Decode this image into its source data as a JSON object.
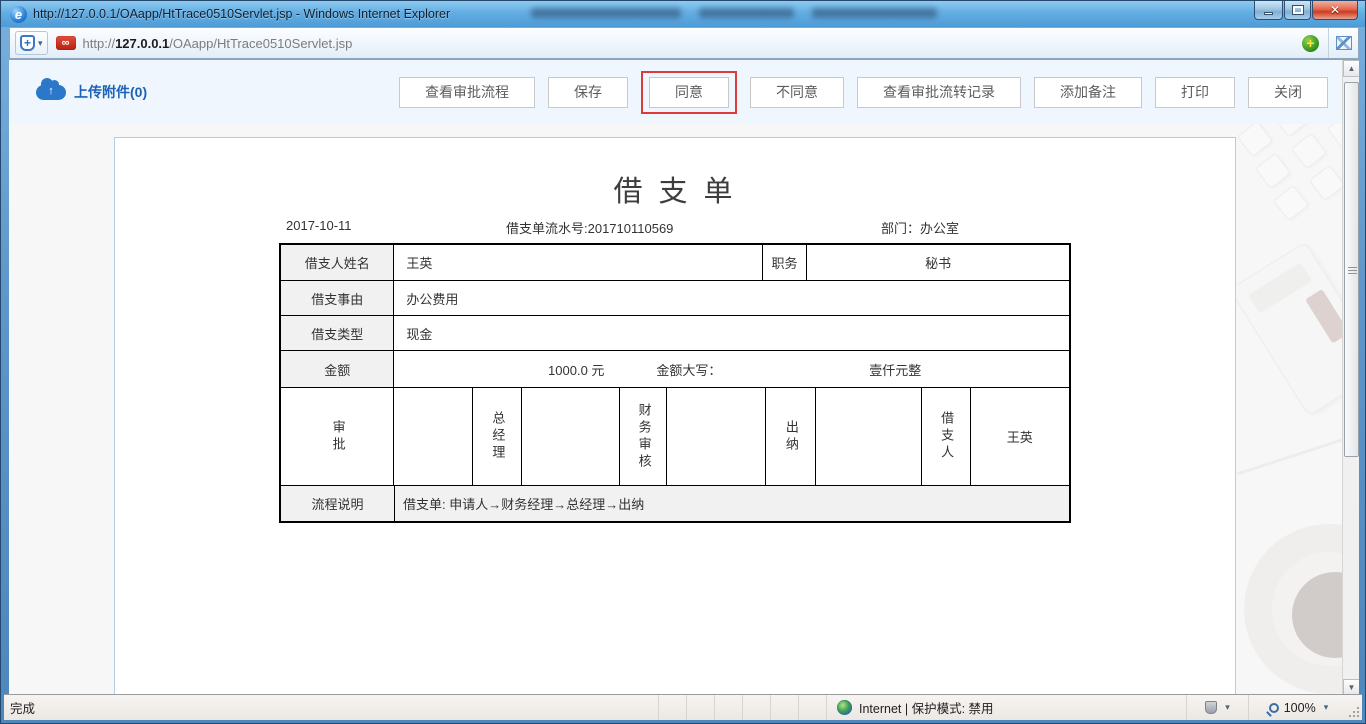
{
  "colors": {
    "highlight_red": "#dd3a3a",
    "link_blue": "#1b62b8",
    "titlebar_blue": "#63ade3"
  },
  "window": {
    "title": "http://127.0.0.1/OAapp/HtTrace0510Servlet.jsp - Windows Internet Explorer"
  },
  "icons": {
    "close_glyph": "✕",
    "dropdown": "▾",
    "scroll_up": "▲",
    "scroll_down": "▼",
    "shield_plus": "+",
    "favicon_glyph": "∞",
    "go_plus": "+",
    "upload_arrow": "↑",
    "ie_logo_glyph": "e"
  },
  "address_bar": {
    "url_scheme": "http://",
    "url_domain": "127.0.0.1",
    "url_path": "/OAapp/HtTrace0510Servlet.jsp"
  },
  "toolbar": {
    "upload_label": "上传附件(0)",
    "buttons": [
      {
        "label": "查看审批流程",
        "highlighted": false
      },
      {
        "label": "保存",
        "highlighted": false
      },
      {
        "label": "同意",
        "highlighted": true
      },
      {
        "label": "不同意",
        "highlighted": false
      },
      {
        "label": "查看审批流转记录",
        "highlighted": false
      },
      {
        "label": "添加备注",
        "highlighted": false
      },
      {
        "label": "打印",
        "highlighted": false
      },
      {
        "label": "关闭",
        "highlighted": false
      }
    ]
  },
  "form": {
    "title": "借 支 单",
    "date": "2017-10-11",
    "serial": "借支单流水号:201710110569",
    "department": "部门：办公室",
    "name_label": "借支人姓名",
    "name_value": "王英",
    "duty_label": "职务",
    "duty_value": "秘书",
    "reason_label": "借支事由",
    "reason_value": "办公费用",
    "type_label": "借支类型",
    "type_value": "现金",
    "amount_label": "金额",
    "amount_value": "1000.0 元",
    "amount_caps_label": "金额大写：",
    "amount_caps_value": "壹仟元整",
    "approval": [
      "审批",
      "",
      "总经理",
      "",
      "财务审核",
      "",
      "出纳",
      "",
      "借支人",
      "王英"
    ],
    "flow_label": "流程说明",
    "flow_value": "借支单: 申请人→财务经理→总经理→出纳"
  },
  "status_bar": {
    "done": "完成",
    "zone_text": "Internet | 保护模式: 禁用",
    "zoom_text": "100%"
  }
}
